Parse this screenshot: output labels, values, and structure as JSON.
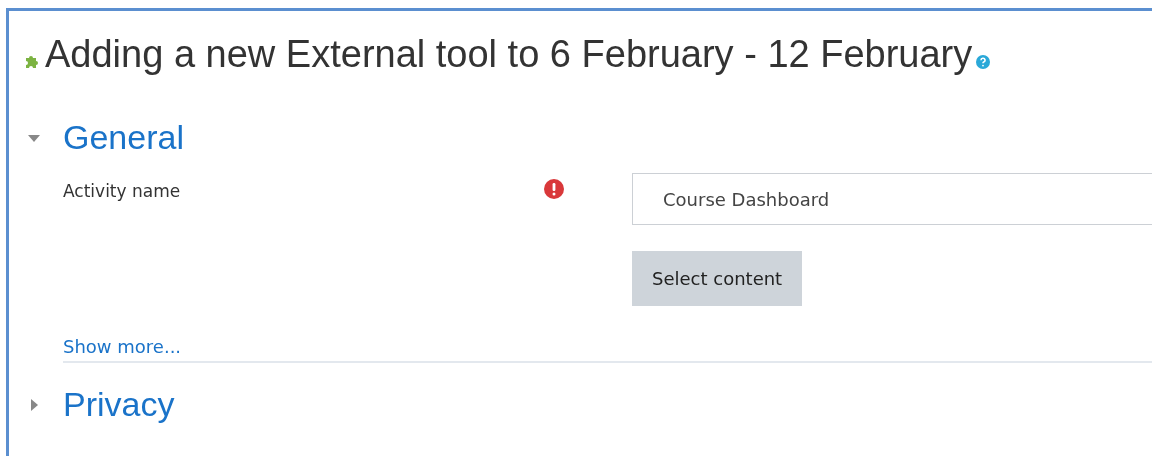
{
  "page_title": "Adding a new External tool to 6 February - 12 February",
  "sections": [
    {
      "title": "General",
      "expanded": true,
      "fields": [
        {
          "label": "Activity name",
          "required": true,
          "value": "Course Dashboard",
          "button": "Select content"
        }
      ],
      "show_more": "Show more..."
    },
    {
      "title": "Privacy",
      "expanded": false
    }
  ]
}
